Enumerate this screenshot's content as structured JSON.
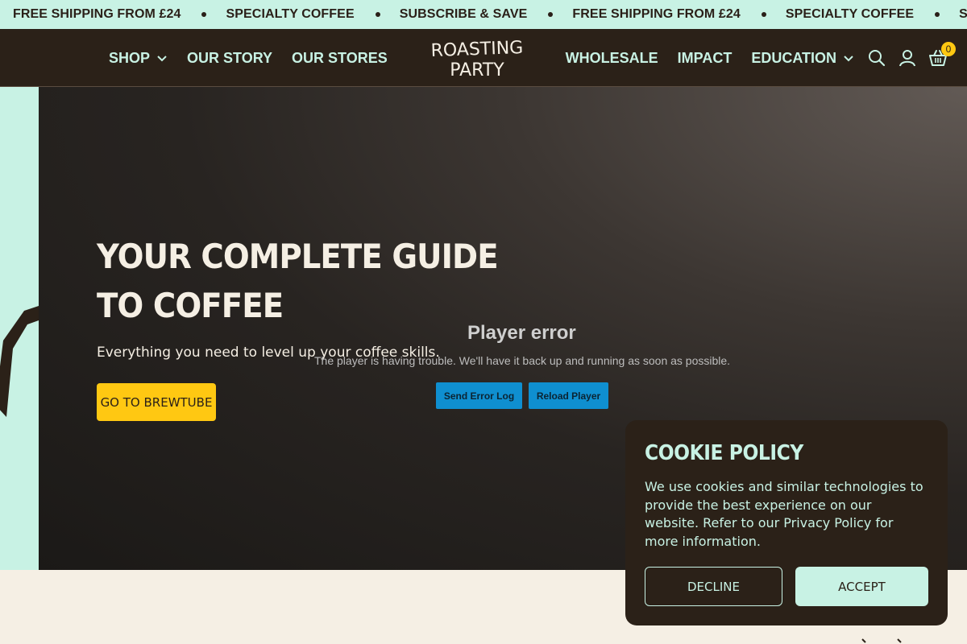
{
  "announcement": {
    "items": [
      "FREE SHIPPING FROM £24",
      "SPECIALTY COFFEE",
      "SUBSCRIBE & SAVE",
      "FREE SHIPPING FROM £24",
      "SPECIALTY COFFEE",
      "SUBSCRIBE & SAVE"
    ]
  },
  "header": {
    "nav_left": [
      "SHOP",
      "OUR STORY",
      "OUR STORES"
    ],
    "nav_right": [
      "WHOLESALE",
      "IMPACT",
      "EDUCATION"
    ],
    "logo_line1": "ROASTING",
    "logo_line2": "PARTY",
    "cart_count": "0"
  },
  "hero": {
    "title": "YOUR COMPLETE GUIDE TO COFFEE",
    "subtitle": "Everything you need to level up your coffee skills.",
    "cta_label": "GO TO BREWTUBE"
  },
  "player": {
    "error_title": "Player error",
    "error_message": "The player is having trouble. We'll have it back up and running as soon as possible.",
    "send_log_label": "Send Error Log",
    "reload_label": "Reload Player"
  },
  "cookie": {
    "title": "COOKIE POLICY",
    "text": "We use cookies and similar technologies to provide the best experience on our website. Refer to our Privacy Policy for more information.",
    "decline_label": "DECLINE",
    "accept_label": "ACCEPT"
  },
  "colors": {
    "mint": "#c8f2e4",
    "dark_brown": "#2b2118",
    "yellow": "#ffc812",
    "cream": "#f5efe4",
    "player_blue": "#0f8fd0"
  },
  "icons": [
    "chevron-down-icon",
    "search-icon",
    "user-icon",
    "basket-icon"
  ]
}
